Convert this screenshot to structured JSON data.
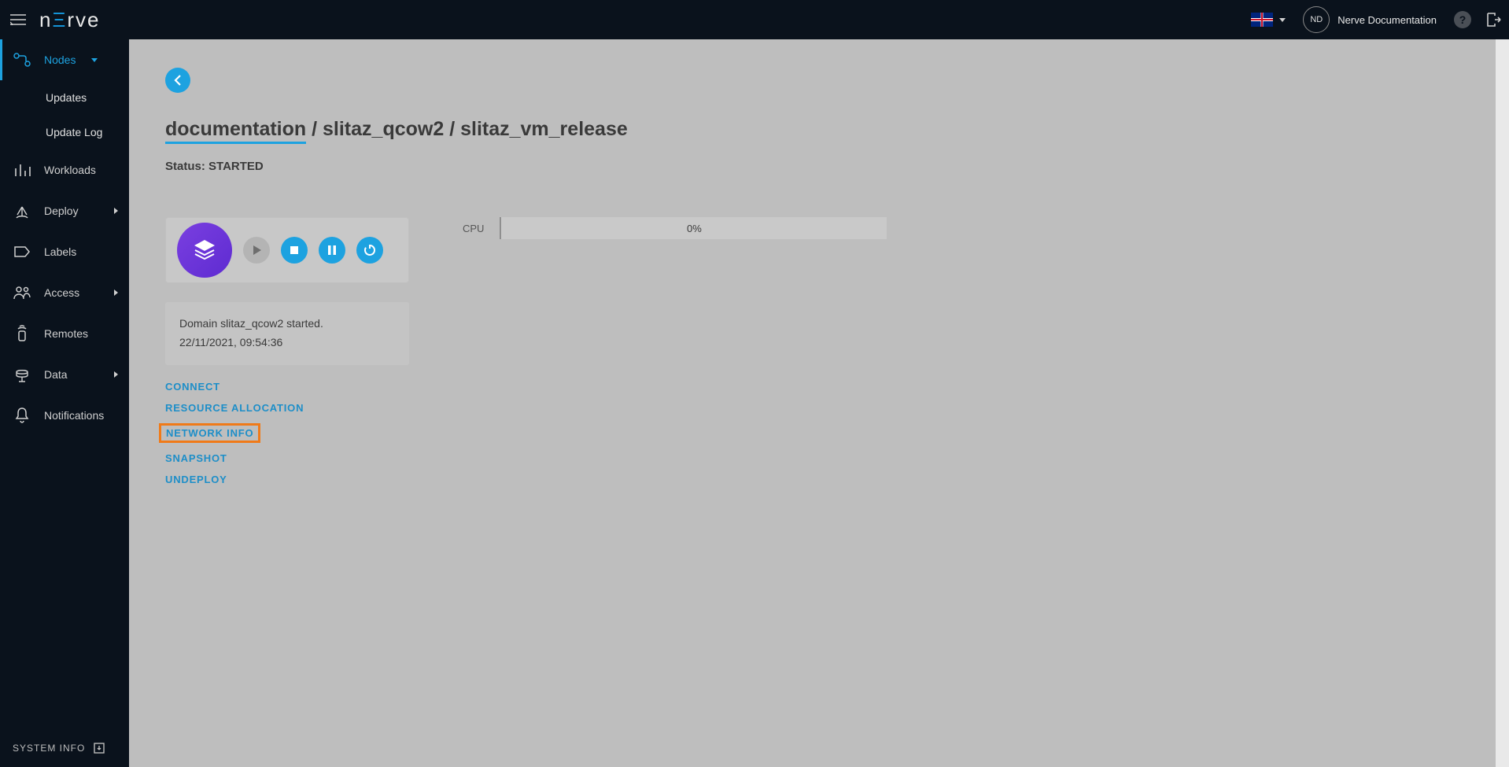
{
  "brand": {
    "n1": "n",
    "e": "Ξ",
    "rve": "rve"
  },
  "header": {
    "avatar_initials": "ND",
    "username": "Nerve Documentation"
  },
  "sidebar": {
    "nodes": "Nodes",
    "updates": "Updates",
    "update_log": "Update Log",
    "workloads": "Workloads",
    "deploy": "Deploy",
    "labels": "Labels",
    "access": "Access",
    "remotes": "Remotes",
    "data": "Data",
    "notifications": "Notifications",
    "system_info": "SYSTEM INFO"
  },
  "breadcrumb": {
    "first": "documentation",
    "sep1": " / ",
    "second": "slitaz_qcow2",
    "sep2": " / ",
    "third": "slitaz_vm_release"
  },
  "status_label": "Status: ",
  "status_value": "STARTED",
  "log": {
    "line1": "Domain slitaz_qcow2 started.",
    "line2": "22/11/2021, 09:54:36"
  },
  "cpu": {
    "label": "CPU",
    "value": "0%"
  },
  "actions": {
    "connect": "CONNECT",
    "resource": "RESOURCE ALLOCATION",
    "network": "NETWORK INFO",
    "snapshot": "SNAPSHOT",
    "undeploy": "UNDEPLOY"
  }
}
